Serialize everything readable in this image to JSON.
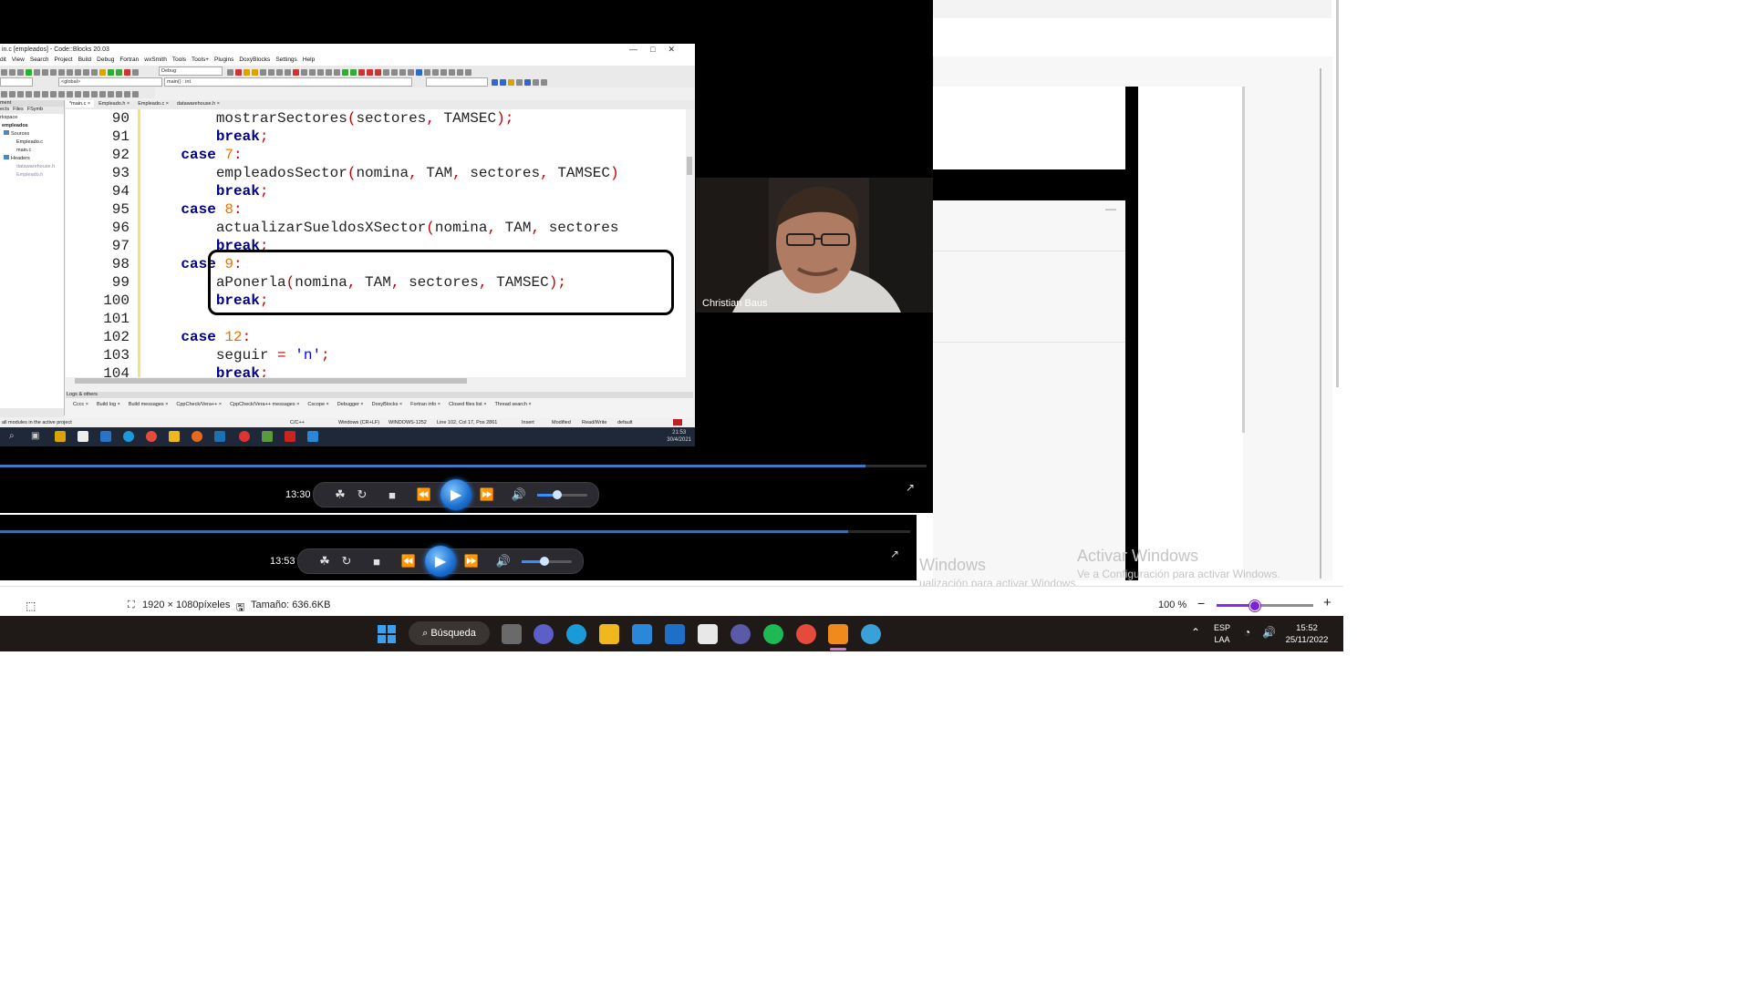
{
  "codeblocks": {
    "title": "in.c [empleados] - Code::Blocks 20.03",
    "menu": [
      "dit",
      "View",
      "Search",
      "Project",
      "Build",
      "Debug",
      "Fortran",
      "wxSmith",
      "Tools",
      "Tools+",
      "Plugins",
      "DoxyBlocks",
      "Settings",
      "Help"
    ],
    "build_target": "Debug",
    "scope_combo": "<global>",
    "function_combo": "main() : int",
    "editor_tabs": [
      "*main.c",
      "Empleado.h",
      "Empleado.c",
      "datawarehouse.h"
    ],
    "management": {
      "header": "ment",
      "tabs": [
        "ects",
        "Files",
        "FSymb"
      ],
      "tree": [
        "rkspace",
        "empleados",
        "Sources",
        "Empleado.c",
        "main.c",
        "Headers",
        "datawarehouse.h",
        "Empleado.h"
      ]
    },
    "code": [
      {
        "ln": "90",
        "tokens": [
          [
            "id",
            "        mostrarSectores"
          ],
          [
            "pn",
            "("
          ],
          [
            "id",
            "sectores"
          ],
          [
            "pn",
            ","
          ],
          [
            "id",
            " TAMSEC"
          ],
          [
            "pn",
            ");"
          ]
        ]
      },
      {
        "ln": "91",
        "tokens": [
          [
            "kw",
            "        break"
          ],
          [
            "pn",
            ";"
          ]
        ]
      },
      {
        "ln": "92",
        "tokens": [
          [
            "kw",
            "    case "
          ],
          [
            "num",
            "7"
          ],
          [
            "pn",
            ":"
          ]
        ]
      },
      {
        "ln": "93",
        "tokens": [
          [
            "id",
            "        empleadosSector"
          ],
          [
            "pn",
            "("
          ],
          [
            "id",
            "nomina"
          ],
          [
            "pn",
            ","
          ],
          [
            "id",
            " TAM"
          ],
          [
            "pn",
            ","
          ],
          [
            "id",
            " sectores"
          ],
          [
            "pn",
            ","
          ],
          [
            "id",
            " TAMSEC"
          ],
          [
            "pn",
            ")"
          ]
        ]
      },
      {
        "ln": "94",
        "tokens": [
          [
            "kw",
            "        break"
          ],
          [
            "pn",
            ";"
          ]
        ]
      },
      {
        "ln": "95",
        "tokens": [
          [
            "kw",
            "    case "
          ],
          [
            "num",
            "8"
          ],
          [
            "pn",
            ":"
          ]
        ]
      },
      {
        "ln": "96",
        "tokens": [
          [
            "id",
            "        actualizarSueldosXSector"
          ],
          [
            "pn",
            "("
          ],
          [
            "id",
            "nomina"
          ],
          [
            "pn",
            ","
          ],
          [
            "id",
            " TAM"
          ],
          [
            "pn",
            ","
          ],
          [
            "id",
            " sectores"
          ]
        ]
      },
      {
        "ln": "97",
        "tokens": [
          [
            "kw",
            "        break"
          ],
          [
            "pn",
            ";"
          ]
        ]
      },
      {
        "ln": "98",
        "tokens": [
          [
            "kw",
            "    case "
          ],
          [
            "num",
            "9"
          ],
          [
            "pn",
            ":"
          ]
        ]
      },
      {
        "ln": "99",
        "tokens": [
          [
            "id",
            "        aPonerla"
          ],
          [
            "pn",
            "("
          ],
          [
            "id",
            "nomina"
          ],
          [
            "pn",
            ","
          ],
          [
            "id",
            " TAM"
          ],
          [
            "pn",
            ","
          ],
          [
            "id",
            " sectores"
          ],
          [
            "pn",
            ","
          ],
          [
            "id",
            " TAMSEC"
          ],
          [
            "pn",
            ");"
          ]
        ]
      },
      {
        "ln": "100",
        "tokens": [
          [
            "kw",
            "        break"
          ],
          [
            "pn",
            ";"
          ]
        ]
      },
      {
        "ln": "101",
        "tokens": []
      },
      {
        "ln": "102",
        "tokens": [
          [
            "kw",
            "    case "
          ],
          [
            "num",
            "12"
          ],
          [
            "pn",
            ":"
          ]
        ]
      },
      {
        "ln": "103",
        "tokens": [
          [
            "id",
            "        seguir "
          ],
          [
            "pn",
            "="
          ],
          [
            "str",
            " 'n'"
          ],
          [
            "pn",
            ";"
          ]
        ]
      },
      {
        "ln": "104",
        "tokens": [
          [
            "kw",
            "        break"
          ],
          [
            "pn",
            ";"
          ]
        ]
      }
    ],
    "logs_header": "Logs & others",
    "log_tabs": [
      "Cccc",
      "Build log",
      "Build messages",
      "CppCheck/Vera++",
      "CppCheck/Vera++ messages",
      "Cscope",
      "Debugger",
      "DoxyBlocks",
      "Fortran info",
      "Closed files list",
      "Thread search"
    ],
    "status": {
      "left": "all modules in the active project",
      "lang": "C/C++",
      "eol": "Windows (CR+LF)",
      "encoding": "WINDOWS-1252",
      "position": "Line 102, Col 17, Pos 2861",
      "insert": "Insert",
      "modified": "Modified",
      "rw": "Read/Write",
      "profile": "default"
    },
    "clock_time": "21:53",
    "clock_date": "30/4/2021"
  },
  "webcam": {
    "name": "Christian Baus"
  },
  "player_front": {
    "time": "13:30",
    "progress": 0.934,
    "volume": 0.4
  },
  "player_back": {
    "time": "13:53",
    "progress": 0.932,
    "volume": 0.45
  },
  "watermark": {
    "left_title": "Windows",
    "left_sub": "ualización para activar Windows.",
    "right_title": "Activar Windows",
    "right_sub": "Ve a Configuración para activar Windows."
  },
  "viewer_status": {
    "dimensions": "1920 × 1080píxeles",
    "size": "Tamaño: 636.6KB",
    "zoom": "100 %",
    "zoom_level": 0.4
  },
  "taskbar": {
    "search_label": "Búsqueda",
    "lang_line1": "ESP",
    "lang_line2": "LAA",
    "time": "15:52",
    "date": "25/11/2022"
  }
}
